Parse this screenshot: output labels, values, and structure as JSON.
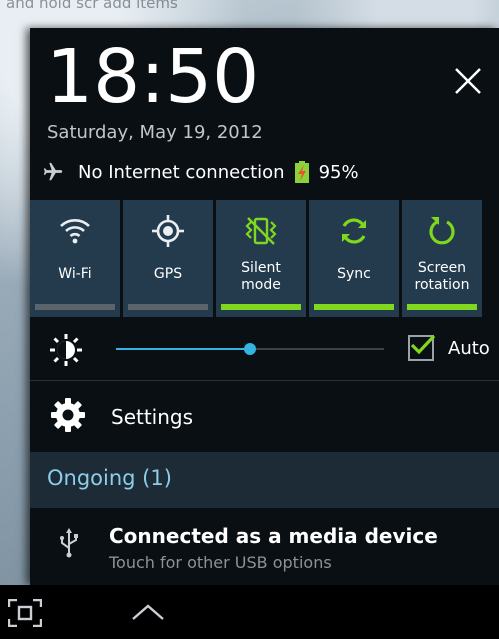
{
  "wallpaper": {
    "text": "and hold scr   add items"
  },
  "header": {
    "time": "18:50",
    "date": "Saturday, May 19, 2012",
    "close_icon": "close-icon"
  },
  "status": {
    "connection": "No Internet connection",
    "battery": "95%",
    "battery_level": 0.95,
    "icons": [
      "airplane-icon",
      "battery-icon"
    ]
  },
  "toggles": [
    {
      "label": "Wi-Fi",
      "icon": "wifi-icon",
      "on": false
    },
    {
      "label": "GPS",
      "icon": "gps-icon",
      "on": false
    },
    {
      "label_line1": "Silent",
      "label_line2": "mode",
      "icon": "silent-mode-icon",
      "on": true
    },
    {
      "label": "Sync",
      "icon": "sync-icon",
      "on": true
    },
    {
      "label_line1": "Screen",
      "label_line2": "rotation",
      "icon": "screen-rotation-icon",
      "on": true
    }
  ],
  "brightness": {
    "level": 0.5,
    "auto_label": "Auto",
    "auto_checked": true
  },
  "settings": {
    "label": "Settings"
  },
  "ongoing": {
    "label": "Ongoing (1)"
  },
  "notification": {
    "title": "Connected as a media device",
    "subtitle": "Touch for other USB options"
  },
  "navbar": {
    "icons": [
      "screenshot-icon",
      "chevron-up-icon"
    ]
  },
  "colors": {
    "accent": "#35b3e3",
    "toggle_on": "#7fd71e",
    "panel_bg": "#0a0f14",
    "toggle_bg": "#233b4d"
  }
}
